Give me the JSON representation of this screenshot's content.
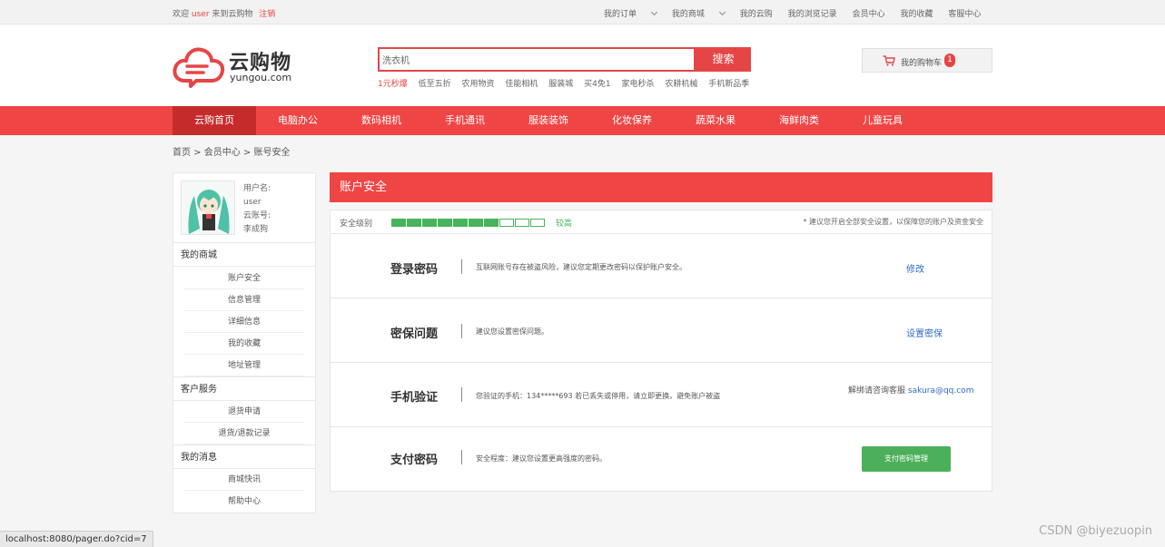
{
  "colors": {
    "brand": "#ef4545",
    "green": "#45b45a",
    "link": "#2e6bc7"
  },
  "topbar": {
    "welcome": "欢迎",
    "username": "user",
    "welcome_suffix": "来到云购物",
    "logout": "注销",
    "links": [
      "我的订单",
      "我的商城",
      "我的云购",
      "我的浏览记录",
      "会员中心",
      "我的收藏",
      "客服中心"
    ]
  },
  "logo": {
    "name": "云购物",
    "domain": "yungou.com"
  },
  "search": {
    "value": "洗衣机",
    "button": "搜索"
  },
  "hotwords": [
    "1元秒爆",
    "低至五折",
    "农用物资",
    "佳能相机",
    "服装城",
    "买4免1",
    "家电秒杀",
    "农耕机械",
    "手机新品季"
  ],
  "cart": {
    "label": "我的购物车",
    "count": "1",
    "icon": "cart-icon"
  },
  "nav": [
    "云购首页",
    "电脑办公",
    "数码相机",
    "手机通讯",
    "服装装饰",
    "化妆保养",
    "蔬菜水果",
    "海鲜肉类",
    "儿童玩具"
  ],
  "breadcrumb": "首页 > 会员中心 > 账号安全",
  "sidebar": {
    "username_label": "用户名:",
    "username": "user",
    "account_label": "云账号:",
    "account": "李成狗",
    "sections": [
      {
        "title": "我的商城",
        "items": [
          "账户安全",
          "信息管理",
          "详细信息",
          "我的收藏",
          "地址管理"
        ]
      },
      {
        "title": "客户服务",
        "items": [
          "退货申请",
          "退货/退款记录"
        ]
      },
      {
        "title": "我的消息",
        "items": [
          "商城快讯",
          "帮助中心"
        ]
      }
    ]
  },
  "panel": {
    "title": "账户安全",
    "level_label": "安全级别",
    "level_value": "较高",
    "level_filled": 7,
    "level_total": 10,
    "tip": "* 建议您开启全部安全设置，以保障您的账户及资金安全",
    "rows": [
      {
        "name": "登录密码",
        "desc": "互联网账号存在被盗风险，建议您定期更改密码以保护账户安全。",
        "action": "修改"
      },
      {
        "name": "密保问题",
        "desc": "建议您设置密保问题。",
        "action": "设置密保"
      },
      {
        "name": "手机验证",
        "desc": "您验证的手机：134*****693 若已丢失或停用，请立即更换，避免账户被盗",
        "note": "解绑请咨询客服",
        "email": "sakura@qq.com"
      },
      {
        "name": "支付密码",
        "desc": "安全程度：建议您设置更高强度的密码。",
        "action": "支付密码管理"
      }
    ]
  },
  "status_url": "localhost:8080/pager.do?cid=7",
  "watermark": "CSDN @biyezuopin"
}
